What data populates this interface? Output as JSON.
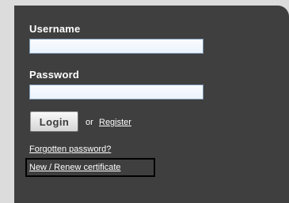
{
  "login_form": {
    "username_label": "Username",
    "username_value": "",
    "password_label": "Password",
    "password_value": "",
    "login_button": "Login",
    "or_text": "or",
    "register_link": "Register",
    "forgot_password_link": "Forgotten password?",
    "renew_certificate_link": "New / Renew certificate"
  },
  "colors": {
    "page_background": "#dcdcdc",
    "panel_background": "#3f3f3f",
    "text": "#ffffff",
    "field_border": "#7f9db9",
    "field_background": "#f3f8fe",
    "focus_outline": "#000000"
  }
}
